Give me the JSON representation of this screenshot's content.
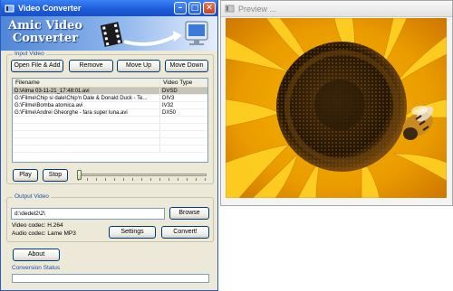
{
  "main_window": {
    "title": "Video Converter",
    "logo_line1": "Amic Video",
    "logo_line2": "Converter"
  },
  "input_video": {
    "group_label": "Input Video",
    "buttons": {
      "open": "Open File & Add",
      "remove": "Remove",
      "move_up": "Move Up",
      "move_down": "Move Down"
    },
    "columns": [
      "Filename",
      "Video Type"
    ],
    "rows": [
      {
        "filename": "D:\\Alma 03-11-21_17:48:01.avi",
        "type": "DVSD"
      },
      {
        "filename": "G:\\Filme\\Chip si dale\\Chip'n Dale & Donald Duck - Te...",
        "type": "DIV3"
      },
      {
        "filename": "G:\\Filme\\Bomba atomica.avi",
        "type": "IV32"
      },
      {
        "filename": "G:\\Filme\\Andrei Gheorghe - fara super luna.avi",
        "type": "DX50"
      }
    ],
    "play_label": "Play",
    "stop_label": "Stop"
  },
  "output_video": {
    "group_label": "Output Video",
    "path": "d:\\dedel2\\2\\",
    "browse_label": "Browse",
    "video_codec": "Video codec: H.264",
    "audio_codec": "Audio codec: Lame MP3",
    "settings_label": "Settings",
    "convert_label": "Convert!"
  },
  "about_label": "About",
  "conversion_status_label": "Conversion Status",
  "preview_window": {
    "title": "Preview ..."
  },
  "colors": {
    "titlebar_blue": "#1c5ad8",
    "group_label_blue": "#1f4ea8",
    "selected_row": "#c6c3b8"
  }
}
